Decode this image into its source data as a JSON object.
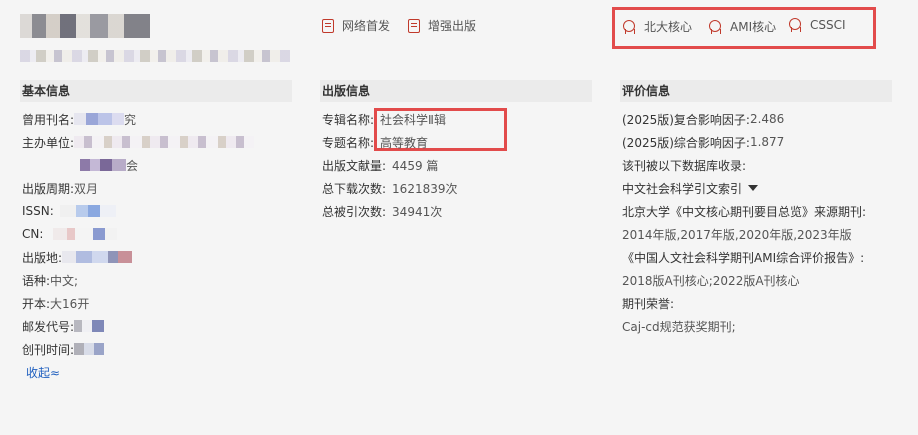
{
  "header": {
    "net_first": "网络首发",
    "enhanced_publish": "增强出版",
    "badges": [
      "北大核心",
      "AMI核心",
      "CSSCI"
    ]
  },
  "basic": {
    "title": "基本信息",
    "name_label": "曾用刊名:",
    "name_value": "究",
    "sponsor_label": "主办单位:",
    "sponsor_value2": "会",
    "cycle_label": "出版周期:",
    "cycle_value": "双月",
    "issn_label": "ISSN:",
    "cn_label": "CN:",
    "place_label": "出版地:",
    "lang_label": "语种:",
    "lang_value": "中文;",
    "format_label": "开本:",
    "format_value": "大16开",
    "postcode_label": "邮发代号:",
    "founded_label": "创刊时间:",
    "collapse": "收起≈"
  },
  "publish": {
    "title": "出版信息",
    "series_label": "专辑名称:",
    "series_value": "社会科学Ⅱ辑",
    "topic_label": "专题名称:",
    "topic_value": "高等教育",
    "articles_label": "出版文献量:",
    "articles_value": "4459 篇",
    "downloads_label": "总下载次数:",
    "downloads_value": "1621839次",
    "citations_label": "总被引次数:",
    "citations_value": "34941次"
  },
  "eval": {
    "title": "评价信息",
    "compound_if": "(2025版)复合影响因子:",
    "compound_if_value": "2.486",
    "overall_if": "(2025版)综合影响因子:",
    "overall_if_value": "1.877",
    "indexed_by": "该刊被以下数据库收录:",
    "cssci_db": "中文社会科学引文索引",
    "pku_core": "北京大学《中文核心期刊要目总览》来源期刊:",
    "pku_years": "2014年版,2017年版,2020年版,2023年版",
    "ami_report": "《中国人文社会科学期刊AMI综合评价报告》:",
    "ami_years": "2018版A刊核心;2022版A刊核心",
    "honors": "期刊荣誉:",
    "honors_value": "Caj-cd规范获奖期刊;"
  },
  "colors": {
    "accent_red": "#e24b4b",
    "icon_red": "#c0392b",
    "link_blue": "#1f5fbf"
  }
}
